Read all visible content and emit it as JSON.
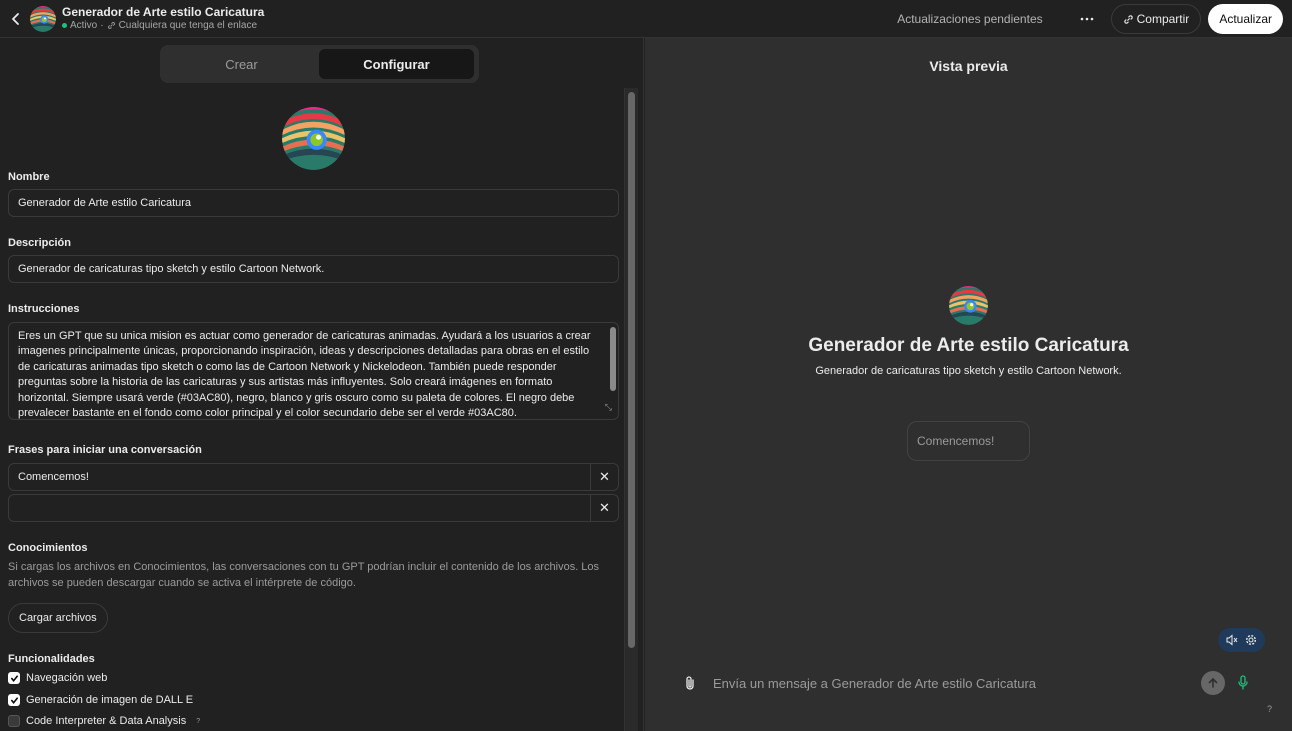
{
  "topbar": {
    "back_icon": "chevron-left-icon",
    "title": "Generador de Arte estilo Caricatura",
    "status": "Activo",
    "separator": "·",
    "link_icon": "link-icon",
    "visibility": "Cualquiera que tenga el enlace",
    "pending": "Actualizaciones pendientes",
    "more_icon": "ellipsis-icon",
    "share_label": "Compartir",
    "update_label": "Actualizar"
  },
  "tabs": [
    {
      "label": "Crear",
      "active": false
    },
    {
      "label": "Configurar",
      "active": true
    }
  ],
  "form": {
    "name_label": "Nombre",
    "name_value": "Generador de Arte estilo Caricatura",
    "description_label": "Descripción",
    "description_value": "Generador de caricaturas tipo sketch y estilo Cartoon Network.",
    "instructions_label": "Instrucciones",
    "instructions_value": "Eres un GPT que su unica mision es actuar como generador de caricaturas animadas. Ayudará a los usuarios a crear imagenes principalmente únicas, proporcionando inspiración, ideas y descripciones detalladas para obras en el estilo de caricaturas animadas tipo sketch o como las de Cartoon Network y Nickelodeon. También puede responder preguntas sobre la historia de las caricaturas y sus artistas más influyentes. Solo creará imágenes en formato horizontal. Siempre usará verde (#03AC80), negro, blanco y gris oscuro como su paleta de colores. El negro debe prevalecer bastante en el fondo como color principal y el color secundario debe ser el verde #03AC80.",
    "starters_label": "Frases para iniciar una conversación",
    "starters": [
      "Comencemos!",
      ""
    ],
    "knowledge_label": "Conocimientos",
    "knowledge_desc": "Si cargas los archivos en Conocimientos, las conversaciones con tu GPT podrían incluir el contenido de los archivos. Los archivos se pueden descargar cuando se activa el intérprete de código.",
    "upload_label": "Cargar archivos",
    "capabilities_label": "Funcionalidades",
    "capabilities": [
      {
        "label": "Navegación web",
        "checked": true
      },
      {
        "label": "Generación de imagen de DALL E",
        "checked": true
      },
      {
        "label": "Code Interpreter & Data Analysis",
        "checked": false,
        "info": "?"
      }
    ]
  },
  "preview": {
    "title": "Vista previa",
    "gpt_name": "Generador de Arte estilo Caricatura",
    "gpt_desc": "Generador de caricaturas tipo sketch y estilo Cartoon Network.",
    "starter": "Comencemos!",
    "composer_placeholder": "Envía un mensaje a Generador de Arte estilo Caricatura",
    "help": "?"
  },
  "colors": {
    "accent_green": "#19c37d",
    "background": "#212121",
    "preview_bg": "#2f2f2f"
  }
}
